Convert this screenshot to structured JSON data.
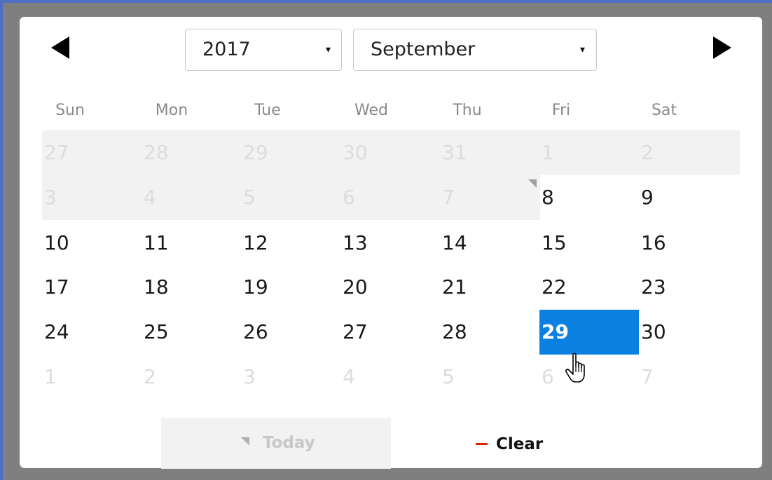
{
  "header": {
    "prev_icon": "triangle-left-icon",
    "next_icon": "triangle-right-icon",
    "year": "2017",
    "month": "September",
    "dropdown_arrow": "▾"
  },
  "weekdays": [
    "Sun",
    "Mon",
    "Tue",
    "Wed",
    "Thu",
    "Fri",
    "Sat"
  ],
  "weeks": [
    [
      "27",
      "28",
      "29",
      "30",
      "31",
      "1",
      "2"
    ],
    [
      "3",
      "4",
      "5",
      "6",
      "7",
      "8",
      "9"
    ],
    [
      "10",
      "11",
      "12",
      "13",
      "14",
      "15",
      "16"
    ],
    [
      "17",
      "18",
      "19",
      "20",
      "21",
      "22",
      "23"
    ],
    [
      "24",
      "25",
      "26",
      "27",
      "28",
      "29",
      "30"
    ],
    [
      "1",
      "2",
      "3",
      "4",
      "5",
      "6",
      "7"
    ]
  ],
  "selected_date": "29",
  "footer": {
    "today_label": "Today",
    "clear_label": "Clear"
  },
  "colors": {
    "selected": "#0a80e0",
    "clear_icon": "#e02000",
    "frame_accent": "#4e6fc4"
  }
}
